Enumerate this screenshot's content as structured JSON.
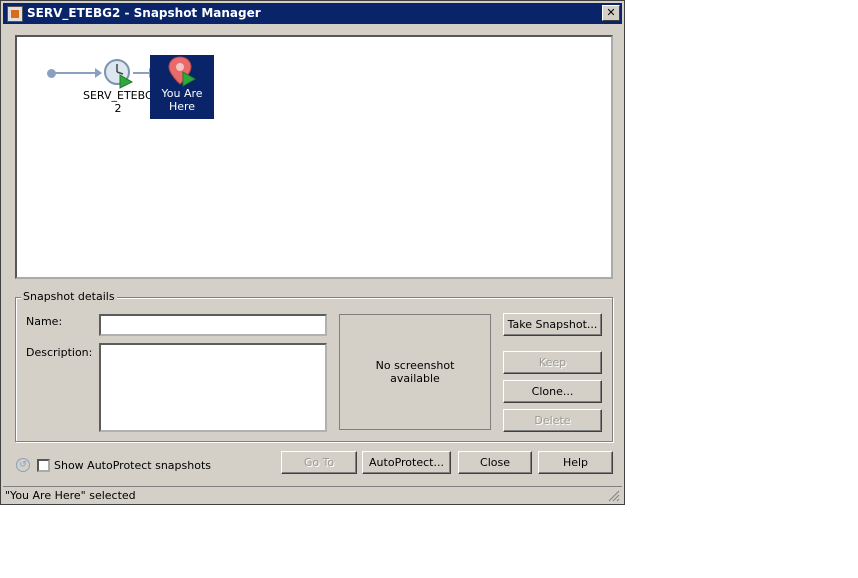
{
  "window": {
    "title": "SERV_ETEBG2 - Snapshot Manager",
    "close_glyph": "✕"
  },
  "tree": {
    "nodes": [
      {
        "label": "SERV_ETEBG\n2",
        "icon": "clock-snapshot-icon"
      },
      {
        "label": "You Are\nHere",
        "icon": "location-pin-icon",
        "selected": true
      }
    ]
  },
  "details": {
    "legend": "Snapshot details",
    "name_label": "Name:",
    "name_value": "",
    "description_label": "Description:",
    "description_value": "",
    "screenshot_text": "No screenshot\navailable"
  },
  "side_buttons": {
    "take_snapshot": "Take Snapshot...",
    "keep": "Keep",
    "clone": "Clone...",
    "delete": "Delete"
  },
  "bottom": {
    "show_autoprotect_label": "Show AutoProtect snapshots",
    "show_autoprotect_checked": false,
    "go_to": "Go To",
    "autoprotect": "AutoProtect...",
    "close": "Close",
    "help": "Help"
  },
  "status": {
    "text": "\"You Are Here\" selected"
  },
  "colors": {
    "selection": "#0a246a",
    "dialog_bg": "#d4d0c8",
    "pin": "#e86a6a",
    "play": "#2faa3a"
  }
}
